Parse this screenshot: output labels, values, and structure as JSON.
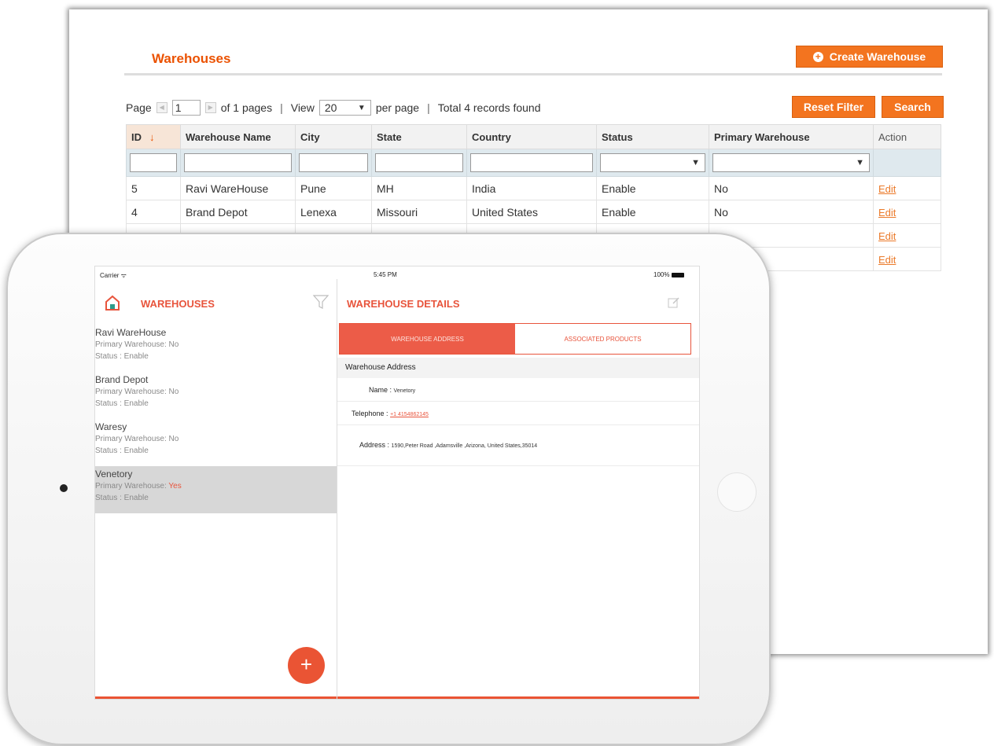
{
  "admin": {
    "title": "Warehouses",
    "create_button": "Create Warehouse",
    "reset_button": "Reset Filter",
    "search_button": "Search",
    "pager": {
      "page_label": "Page",
      "page_value": "1",
      "of_pages": "of 1 pages",
      "sep": "|",
      "view_label": "View",
      "view_value": "20",
      "per_page": "per page",
      "total": "Total 4 records found"
    },
    "columns": [
      "ID",
      "Warehouse Name",
      "City",
      "State",
      "Country",
      "Status",
      "Primary Warehouse",
      "Action"
    ],
    "rows": [
      {
        "id": "5",
        "name": "Ravi WareHouse",
        "city": "Pune",
        "state": "MH",
        "country": "India",
        "status": "Enable",
        "primary": "No",
        "action": "Edit"
      },
      {
        "id": "4",
        "name": "Brand Depot",
        "city": "Lenexa",
        "state": "Missouri",
        "country": "United States",
        "status": "Enable",
        "primary": "No",
        "action": "Edit"
      },
      {
        "id": "",
        "name": "",
        "city": "",
        "state": "",
        "country": "",
        "status": "",
        "primary": "",
        "action": "Edit"
      },
      {
        "id": "",
        "name": "",
        "city": "",
        "state": "",
        "country": "",
        "status": "",
        "primary": "",
        "action": "Edit"
      }
    ]
  },
  "tablet": {
    "status_bar": {
      "carrier": "Carrier ᯤ",
      "time": "5:45 PM",
      "battery": "100%"
    },
    "list_title": "WAREHOUSES",
    "warehouses": [
      {
        "name": "Ravi WareHouse",
        "primary_label": "Primary Warehouse: ",
        "primary_value": "No",
        "status": "Status : Enable"
      },
      {
        "name": "Brand Depot",
        "primary_label": "Primary Warehouse: ",
        "primary_value": "No",
        "status": "Status : Enable"
      },
      {
        "name": "Waresy",
        "primary_label": "Primary Warehouse: ",
        "primary_value": "No",
        "status": "Status : Enable"
      },
      {
        "name": "Venetory",
        "primary_label": "Primary Warehouse: ",
        "primary_value": "Yes",
        "status": "Status : Enable"
      }
    ],
    "fab": "+",
    "detail_title": "WAREHOUSE DETAILS",
    "tabs": {
      "address": "WAREHOUSE ADDRESS",
      "products": "ASSOCIATED PRODUCTS"
    },
    "section_header": "Warehouse Address",
    "name_label": "Name :",
    "name_value": "Venetory",
    "telephone_label": "Telephone :",
    "telephone_value": "+1 4154862145",
    "address_label": "Address :",
    "address_value": "1590,Peter Road ,Adamsville ,Arizona, United States,35014"
  },
  "colors": {
    "accent": "#eb5202",
    "app_accent": "#e8543c",
    "button": "#f3741f"
  },
  "icons": [
    "plus-circle-icon",
    "sort-down-icon",
    "dropdown-icon",
    "warehouse-logo-icon",
    "filter-icon",
    "edit-icon",
    "add-icon",
    "wifi-icon",
    "battery-icon"
  ]
}
